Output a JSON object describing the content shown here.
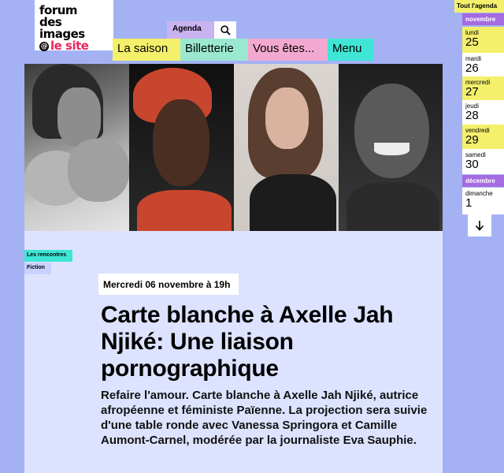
{
  "logo": {
    "line1": "forum",
    "line2": "des images",
    "line3": "le site"
  },
  "nav": {
    "agenda": "Agenda",
    "search_icon": "search-icon",
    "items": [
      "La saison",
      "Billetterie",
      "Vous êtes...",
      "Menu"
    ]
  },
  "sidebar": {
    "all_agenda": "Tout l'agenda",
    "month_nov": "novembre",
    "month_dec": "décembre",
    "days": [
      {
        "name": "lundi",
        "num": "25"
      },
      {
        "name": "mardi",
        "num": "26"
      },
      {
        "name": "mercredi",
        "num": "27"
      },
      {
        "name": "jeudi",
        "num": "28"
      },
      {
        "name": "vendredi",
        "num": "29"
      },
      {
        "name": "samedi",
        "num": "30"
      },
      {
        "name": "dimanche",
        "num": "1"
      }
    ],
    "scroll_icon": "arrow-down-icon"
  },
  "event": {
    "tags": [
      "Les rencontres",
      "Fiction"
    ],
    "date": "Mercredi 06 novembre à 19h",
    "title": "Carte blanche à Axelle Jah Njiké: Une liaison pornographique",
    "description": "Refaire l'amour. Carte blanche à Axelle Jah Njiké, autrice afropéenne et féministe Païenne. La projection sera suivie d'une table ronde avec Vanessa Springora et Camille Aumont-Carnel, modérée par la journaliste Eva Sauphie."
  },
  "colors": {
    "background": "#a4b2f3",
    "content": "#dde3ff",
    "yellow": "#f4f06c",
    "purple": "#a56be0",
    "pink": "#e8265e"
  }
}
